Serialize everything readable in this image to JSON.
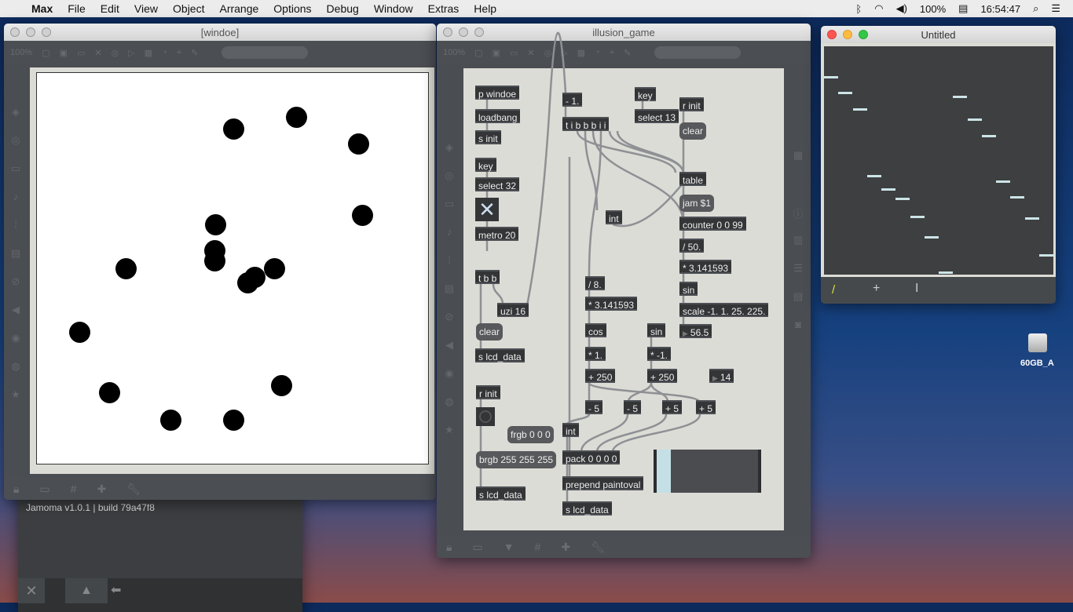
{
  "menubar": {
    "apple": "",
    "app": "Max",
    "items": [
      "File",
      "Edit",
      "View",
      "Object",
      "Arrange",
      "Options",
      "Debug",
      "Window",
      "Extras",
      "Help"
    ],
    "battery": "100%",
    "time": "16:54:47"
  },
  "windows": {
    "windoe": {
      "title": "[windoe]",
      "zoom": "100%"
    },
    "patcher": {
      "title": "illusion_game",
      "zoom": "100%"
    },
    "lcd": {
      "title": "Untitled"
    }
  },
  "patcher": {
    "objects": [
      "p windoe",
      "loadbang",
      "s init",
      "key",
      "select 32",
      "metro 20",
      "t b b",
      "uzi 16",
      "clear",
      "s lcd_data",
      "r init",
      "frgb 0 0 0",
      "brgb 255 255 255",
      "s lcd_data",
      "- 1.",
      "t i b b b i i",
      "key",
      "select 13",
      "r init",
      "clear",
      "table",
      "jam $1",
      "counter 0 0 99",
      "/ 50.",
      "* 3.141593",
      "sin",
      "scale -1. 1. 25. 225.",
      "56.5",
      "int",
      "/ 8.",
      "* 3.141593",
      "cos",
      "sin",
      "* 1.",
      "* -1.",
      "+ 250",
      "+ 250",
      "14",
      "- 5",
      "- 5",
      "+ 5",
      "+ 5",
      "int",
      "pack 0 0 0 0",
      "prepend paintoval",
      "s lcd_data"
    ],
    "slider_value_fraction": 0.14
  },
  "console": {
    "text": "Jamoma  v1.0.1  |  build 79a47f8"
  },
  "desktop": {
    "drive_label": "60GB_A"
  }
}
